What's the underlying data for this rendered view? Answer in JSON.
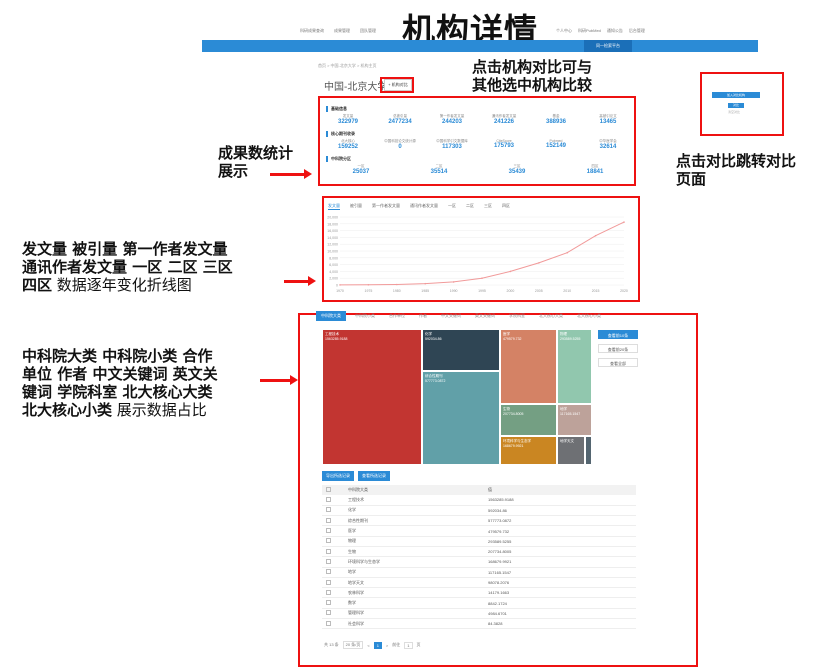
{
  "slide_title": "机构详情",
  "topnav": {
    "left": [
      "科研成果查询",
      "成果管理",
      "团队管理"
    ],
    "right": [
      "个人中心",
      "科研PubMed",
      "通知公告",
      "后台管理"
    ]
  },
  "bluebar_tab": "同一检索平台",
  "breadcrumb": "首页 > 中国-北京大学 > 机构主页",
  "institution_name": "中国-北京大学",
  "compare_button": "+ 机构对比",
  "stats": {
    "groups": [
      {
        "title": "基础信息",
        "items": [
          {
            "label": "发文量",
            "value": "322979"
          },
          {
            "label": "总被引量",
            "value": "2477234"
          },
          {
            "label": "第一作者发文量",
            "value": "244203"
          },
          {
            "label": "通讯作者发文量",
            "value": "241226"
          },
          {
            "label": "基金",
            "value": "388936"
          },
          {
            "label": "高被引论文",
            "value": "13465"
          }
        ]
      },
      {
        "title": "核心期刊收录",
        "items": [
          {
            "label": "北大核心",
            "value": "159252"
          },
          {
            "label": "中国科技论文统计源",
            "value": "0"
          },
          {
            "label": "中国科学引文数据库",
            "value": "117303"
          },
          {
            "label": "CiteScore",
            "value": "175793"
          },
          {
            "label": "Pubmed",
            "value": "152149"
          },
          {
            "label": "中华医学会",
            "value": "32614"
          }
        ]
      },
      {
        "title": "中科院分区",
        "items": [
          {
            "label": "一区",
            "value": "25037"
          },
          {
            "label": "二区",
            "value": "35514"
          },
          {
            "label": "三区",
            "value": "35439"
          },
          {
            "label": "四区",
            "value": "18841"
          }
        ]
      }
    ]
  },
  "chart_tabs": [
    "发文量",
    "被引量",
    "第一作者发文量",
    "通讯作者发文量",
    "一区",
    "二区",
    "三区",
    "四区"
  ],
  "chart_data": {
    "type": "line",
    "x": [
      "1970",
      "1975",
      "1980",
      "1985",
      "1990",
      "1995",
      "2000",
      "2005",
      "2010",
      "2015",
      "2020"
    ],
    "series": [
      {
        "values": [
          20,
          60,
          150,
          400,
          900,
          2000,
          4000,
          6500,
          9500,
          14500,
          18500
        ]
      }
    ],
    "ylim": [
      0,
      20000
    ],
    "ytick_labels": [
      "20,000",
      "18,000",
      "16,000",
      "14,000",
      "12,000",
      "10,000",
      "8,000",
      "6,000",
      "4,000",
      "2,000",
      "0"
    ]
  },
  "treemap_tabs": [
    "中科院大类",
    "中科院小类",
    "合作单位",
    "作者",
    "中文关键词",
    "英文关键词",
    "学院科室",
    "北大核心大类",
    "北大核心小类"
  ],
  "treemap": [
    {
      "name": "工程技术",
      "value": "1563285.9188",
      "color": "#c23531"
    },
    {
      "name": "化学",
      "value": "592034.86",
      "color": "#2f4554"
    },
    {
      "name": "综合性期刊",
      "value": "577773.0872",
      "color": "#61a0a8"
    },
    {
      "name": "医学",
      "value": "479579.732",
      "color": "#d48265"
    },
    {
      "name": "物理",
      "value": "293589.5255",
      "color": "#91c7ae"
    },
    {
      "name": "生物",
      "value": "207734.8005",
      "color": "#749f83"
    },
    {
      "name": "环境科学与生态学",
      "value": "168679.9921",
      "color": "#ca8622"
    },
    {
      "name": "地学",
      "value": "117165.1547",
      "color": "#bda29a"
    },
    {
      "name": "地学天文",
      "value": "",
      "color": "#6e7074"
    },
    {
      "name": "",
      "value": "",
      "color": "#546570"
    }
  ],
  "side_buttons": [
    "查看前10条",
    "查看前20条",
    "查看全部"
  ],
  "action_buttons": [
    "导出所选记录",
    "查看所选记录"
  ],
  "table": {
    "headers": [
      "中科院大类",
      "值"
    ],
    "rows": [
      [
        "工程技术",
        "1563285.9188"
      ],
      [
        "化学",
        "592034.86"
      ],
      [
        "综合性期刊",
        "577773.0872"
      ],
      [
        "医学",
        "479579.732"
      ],
      [
        "物理",
        "293589.5255"
      ],
      [
        "生物",
        "207734.8005"
      ],
      [
        "环境科学与生态学",
        "168679.9921"
      ],
      [
        "地学",
        "117165.1547"
      ],
      [
        "地学天文",
        "98078.2076"
      ],
      [
        "农林科学",
        "14179.1663"
      ],
      [
        "数学",
        "8842.1724"
      ],
      [
        "管理科学",
        "4984.6701"
      ],
      [
        "社会科学",
        "84.3828"
      ]
    ]
  },
  "pager": {
    "total": "共 13 条",
    "per_page": "20 条/页",
    "prev": "<",
    "page": "1",
    "next": ">",
    "goto": "前往",
    "goto_page": "1",
    "page_suffix": "页"
  },
  "popup": {
    "bar": "加入对比机构",
    "btn": "对比",
    "sub": "清空对比"
  },
  "annotations": {
    "compare": "点击机构对比可与\n其他选中机构比较",
    "jump": "点击对比跳转对比\n页面",
    "stats": "成果数统计\n展示",
    "line_bold": "发文量 被引量 第一作者发文量\n通讯作者发文量 一区 二区 三区\n四区",
    "line_normal": " 数据逐年变化折线图",
    "treemap_bold": "中科院大类 中科院小类 合作\n单位 作者 中文关键词 英文关\n键词 学院科室 北大核心大类\n北大核心小类",
    "treemap_normal": " 展示数据占比"
  }
}
